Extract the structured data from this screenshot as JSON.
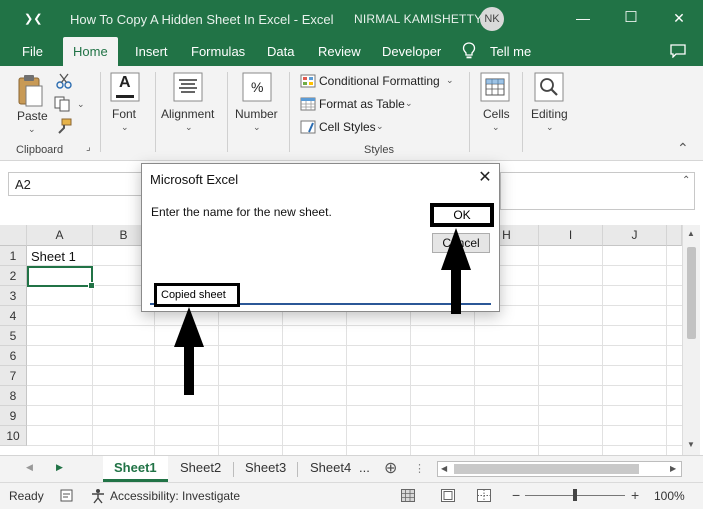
{
  "window": {
    "grip": "❯❮",
    "title": "How To Copy A Hidden Sheet In Excel  -  Excel",
    "user": "NIRMAL KAMISHETTY",
    "avatar": "NK",
    "min": "—",
    "max": "☐",
    "close": "✕"
  },
  "tabs": [
    "File",
    "Home",
    "Insert",
    "Formulas",
    "Data",
    "Review",
    "Developer"
  ],
  "tell_me": "Tell me",
  "ribbon": {
    "paste": "Paste",
    "clipboard": "Clipboard",
    "font": "Font",
    "alignment": "Alignment",
    "number": "Number",
    "number_symbol": "%",
    "font_symbol": "A",
    "conditional_formatting": "Conditional Formatting",
    "format_as_table": "Format as Table",
    "cell_styles": "Cell Styles",
    "styles": "Styles",
    "cells": "Cells",
    "editing": "Editing"
  },
  "formula_bar": {
    "name_box": "A2"
  },
  "grid": {
    "columns": [
      "A",
      "B",
      "",
      "",
      "",
      "",
      "",
      "H",
      "I",
      "J"
    ],
    "rows": [
      "1",
      "2",
      "3",
      "4",
      "5",
      "6",
      "7",
      "8",
      "9",
      "10"
    ],
    "a1": "Sheet 1"
  },
  "sheets": {
    "tabs": [
      "Sheet1",
      "Sheet2",
      "Sheet3",
      "Sheet4"
    ],
    "more": "...",
    "add": "⊕",
    "prev": "◀",
    "next": "▶"
  },
  "status": {
    "ready": "Ready",
    "accessibility": "Accessibility: Investigate",
    "zoom_minus": "−",
    "zoom_plus": "+",
    "zoom": "100%",
    "zoom_level_percent": 100
  },
  "dialog": {
    "title": "Microsoft Excel",
    "close": "✕",
    "prompt": "Enter the name for the new sheet.",
    "ok": "OK",
    "cancel": "Cancel",
    "value": "Copied sheet"
  },
  "colors": {
    "brand": "#217346",
    "annotation": "#000000"
  }
}
